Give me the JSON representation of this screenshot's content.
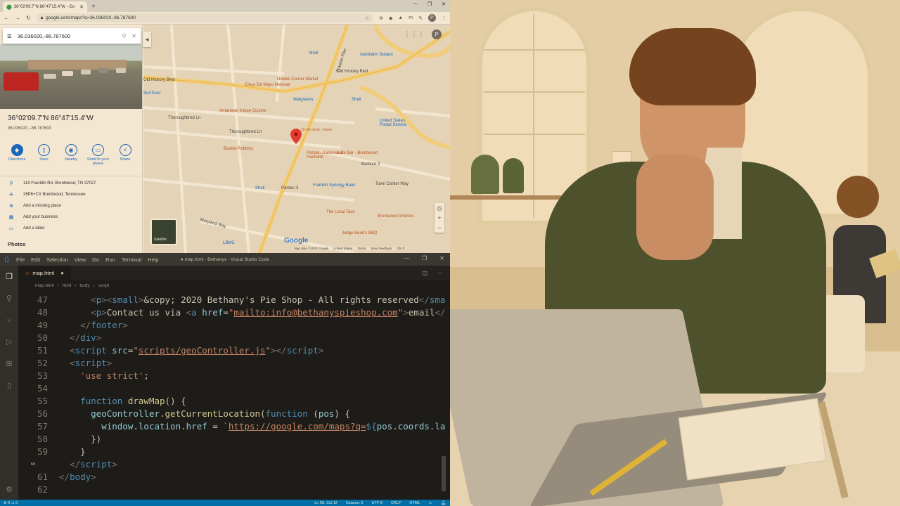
{
  "browser": {
    "tab_title": "36°02'09.7\"N 86°47'15.4\"W - Go",
    "url": "google.com/maps?q=36.036020,-86.787600",
    "avatar_letter": "P"
  },
  "maps_panel": {
    "search_value": "36.036020,-86.787600",
    "coord_title": "36°02'09.7\"N 86°47'15.4\"W",
    "coord_sub": "36.036020, -86.787600",
    "actions": [
      "Directions",
      "Save",
      "Nearby",
      "Send to your phone",
      "Share"
    ],
    "info": [
      {
        "icon": "location-pin-icon",
        "text": "119 Franklin Rd, Brentwood, TN 37027"
      },
      {
        "icon": "plus-code-icon",
        "text": "26P6+CX Brentwood, Tennessee"
      },
      {
        "icon": "add-place-icon",
        "text": "Add a missing place"
      },
      {
        "icon": "business-icon",
        "text": "Add your business"
      },
      {
        "icon": "label-icon",
        "text": "Add a label"
      }
    ],
    "photos_label": "Photos"
  },
  "map": {
    "roads": [
      "Old Hickory Blvd",
      "Old Hickory Blvd",
      "Franklin Pike",
      "Thoroughbred Ln",
      "Thoroughbred Ln",
      "Maryland Way",
      "Town Center Way"
    ],
    "pois": [
      "Shell",
      "Autobahn Subaru",
      "Nobles Corner Market",
      "Cinco De Mayo Mexican",
      "Walgreens",
      "Amaravati Indian Cuisine",
      "Shell",
      "United States Postal Service",
      "Baskin-Robbins",
      "Persian Galleries of Nashville",
      "Juice Bar - Brentwood",
      "Barbour 3",
      "Franklin Synergy Bank",
      "Shell",
      "Parlour 3",
      "The Local Taco",
      "Brentwood Interiors",
      "Judge Bean's BBQ",
      "LBMC",
      "SunTrust"
    ],
    "pin_label": "10 min drive - home",
    "satellite_label": "Satellite",
    "attribution": [
      "Map data ©2020 Google",
      "United States",
      "Terms",
      "Send feedback",
      "200 ft"
    ],
    "google_logo": "Google"
  },
  "vscode": {
    "menu": [
      "File",
      "Edit",
      "Selection",
      "View",
      "Go",
      "Run",
      "Terminal",
      "Help"
    ],
    "window_title": "● map.html - Bethanys - Visual Studio Code",
    "tab": "map.html",
    "breadcrumbs": [
      "map.html",
      "html",
      "body",
      "script"
    ],
    "line_numbers": [
      "47",
      "48",
      "49",
      "50",
      "51",
      "52",
      "53",
      "54",
      "55",
      "56",
      "57",
      "58",
      "59",
      "60",
      "61",
      "62"
    ],
    "status_left": "⊗ 0 ⚠ 0",
    "status_right": [
      "Ln 60, Col 12",
      "Spaces: 2",
      "UTF-8",
      "CRLF",
      "HTML"
    ]
  }
}
